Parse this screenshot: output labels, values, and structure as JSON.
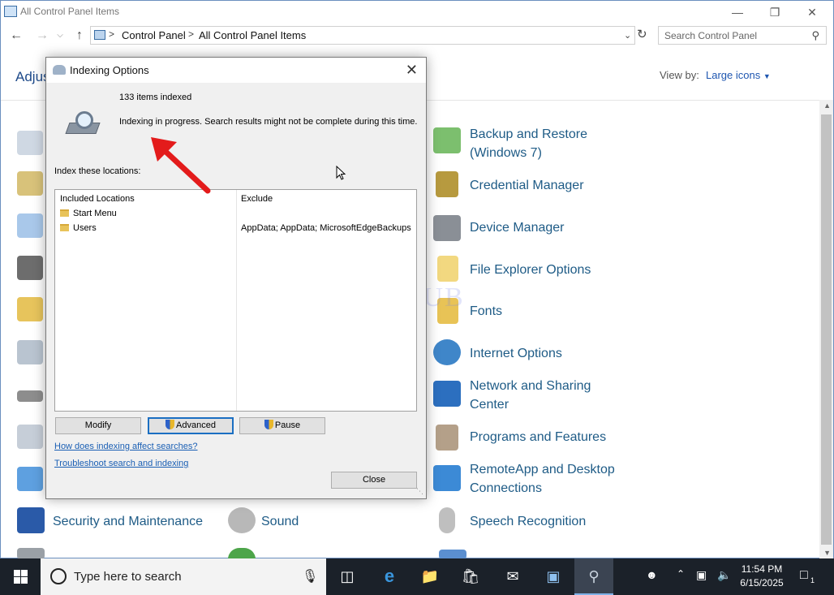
{
  "window": {
    "title": "All Control Panel Items"
  },
  "address": {
    "crumbs": [
      "Control Panel",
      "All Control Panel Items"
    ],
    "search_placeholder": "Search Control Panel"
  },
  "header": {
    "adjust_label": "Adjus",
    "view_by_label": "View by:",
    "view_by_value": "Large icons"
  },
  "items": {
    "right": [
      {
        "label": "Backup and Restore\n(Windows 7)",
        "icon": "backup-restore-icon"
      },
      {
        "label": "Credential Manager",
        "icon": "credential-manager-icon"
      },
      {
        "label": "Device Manager",
        "icon": "device-manager-icon"
      },
      {
        "label": "File Explorer Options",
        "icon": "file-explorer-options-icon"
      },
      {
        "label": "Fonts",
        "icon": "fonts-icon"
      },
      {
        "label": "Internet Options",
        "icon": "internet-options-icon"
      },
      {
        "label": "Network and Sharing\nCenter",
        "icon": "network-sharing-icon"
      },
      {
        "label": "Programs and Features",
        "icon": "programs-features-icon"
      },
      {
        "label": "RemoteApp and Desktop\nConnections",
        "icon": "remoteapp-icon"
      },
      {
        "label": "Speech Recognition",
        "icon": "microphone-icon"
      }
    ],
    "bottom": [
      {
        "label": "Security and Maintenance",
        "icon": "flag-icon"
      },
      {
        "label": "Sound",
        "icon": "speaker-icon"
      }
    ]
  },
  "dialog": {
    "title": "Indexing Options",
    "items_indexed": "133 items indexed",
    "status": "Indexing in progress. Search results might not be complete during this time.",
    "index_label": "Index these locations:",
    "col_included": "Included Locations",
    "col_exclude": "Exclude",
    "locations": [
      {
        "name": "Start Menu",
        "exclude": ""
      },
      {
        "name": "Users",
        "exclude": "AppData; AppData; MicrosoftEdgeBackups"
      }
    ],
    "modify_label": "Modify",
    "advanced_label": "Advanced",
    "pause_label": "Pause",
    "link_affect": "How does indexing affect searches?",
    "link_troubleshoot": "Troubleshoot search and indexing",
    "close_label": "Close"
  },
  "watermark": "IT Pros HUB",
  "taskbar": {
    "search_placeholder": "Type here to search",
    "time": "11:54 PM",
    "date": "6/15/2025",
    "notification_count": "1"
  }
}
